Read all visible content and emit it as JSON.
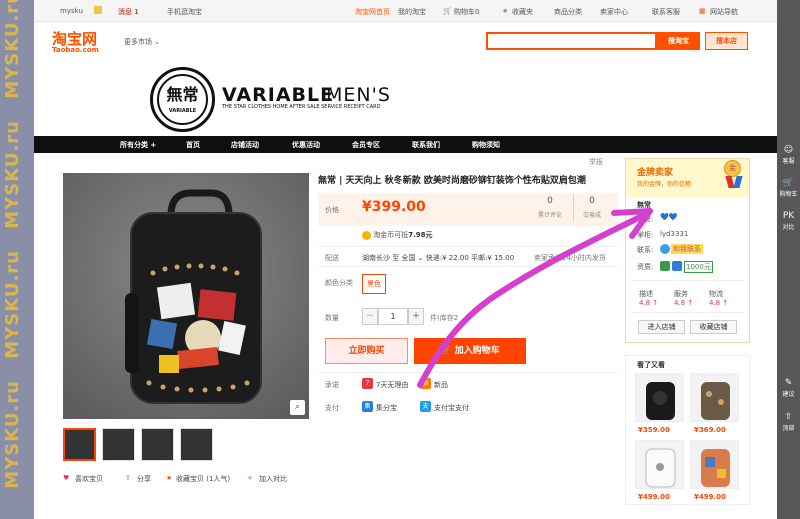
{
  "watermark": {
    "text": "MYSKU.ru"
  },
  "topbar": {
    "brand": "mysku",
    "messages_label": "消息 1",
    "mobile_label": "手机逛淘宝",
    "home_label": "淘宝网首页",
    "my_taobao": "我的淘宝",
    "cart_label": "购物车0",
    "favorites": "收藏夹",
    "categories": "商品分类",
    "seller_center": "卖家中心",
    "contact": "联系客服",
    "site_nav": "网站导航"
  },
  "header": {
    "logo_cn": "淘宝网",
    "logo_en": "Taobao.com",
    "more_markets": "更多市场",
    "search_placeholder": "",
    "search_button": "搜淘宝",
    "store_button": "搜本店"
  },
  "banner": {
    "logo_cn": "無常",
    "logo_en": "VARIABLE",
    "brand_bold": "VARIABLE",
    "brand_light": "MEN'S",
    "tagline": "THE STAR CLOTHES HOME AFTER SALE SERVICE RECEIPT CARD"
  },
  "nav": {
    "items": [
      "所有分类 +",
      "首页",
      "店铺活动",
      "优惠活动",
      "会员专区",
      "联系我们",
      "购物须知"
    ]
  },
  "product": {
    "report": "举报",
    "title": "無常 | 天天向上 秋冬新款 欧美时尚磨砂铆钉装饰个性布贴双肩包潮",
    "price_label": "价格",
    "price": "¥399.00",
    "reviews_count": "0",
    "reviews_label": "累计评论",
    "trades_count": "0",
    "trades_label": "交易成",
    "coin_text": "淘金币可抵",
    "coin_value": "7.98元",
    "shipping_label": "配送",
    "shipping_text": "湖南长沙  至  全国 ⌄  快递:¥ 22.00  平邮:¥ 15.00",
    "shipping_note": "卖家承诺24小时内发货",
    "color_label": "颜色分类",
    "color_option": "黑色",
    "qty_label": "数量",
    "qty_minus": "−",
    "qty_value": "1",
    "qty_plus": "+",
    "qty_unit": "件(库存2",
    "buy_now": "立即购买",
    "add_cart": "加入购物车",
    "promise_label": "承诺",
    "promise_1": "7天无理由",
    "promise_2": "新品",
    "payment_label": "支付",
    "payment_1": "集分宝",
    "payment_2": "支付宝支付",
    "share": {
      "like": "喜欢宝贝",
      "share": "分享",
      "favorite": "收藏宝贝 (1人气)",
      "compare": "加入对比"
    }
  },
  "seller": {
    "badge_title": "金牌卖家",
    "badge_sub": "我的金牌，你的信赖",
    "name": "無常",
    "credit_label": "信誉:",
    "credit_icons": "💙💙",
    "owner_label": "掌柜:",
    "owner": "lyd3331",
    "contact_label": "联系:",
    "contact_text": "和我联系",
    "qual_label": "资质:",
    "qual_text": "1000元",
    "dsr": [
      {
        "label": "描述",
        "value": "4.8 ↑"
      },
      {
        "label": "服务",
        "value": "4.8 ↑"
      },
      {
        "label": "物流",
        "value": "4.8 ↑"
      }
    ],
    "enter_store": "进入店铺",
    "fav_store": "收藏店铺"
  },
  "also_viewed": {
    "title": "看了又看",
    "items": [
      {
        "price": "¥359.00"
      },
      {
        "price": "¥369.00"
      },
      {
        "price": "¥499.00"
      },
      {
        "price": "¥499.00"
      }
    ]
  },
  "right_bar": {
    "service": "客服",
    "cart": "购物车",
    "compare": "对比",
    "suggest": "建议",
    "top": "顶部"
  },
  "colors": {
    "taobao_orange": "#ff5000",
    "price_red": "#ff4400",
    "annotation_magenta": "#d53fd0"
  }
}
